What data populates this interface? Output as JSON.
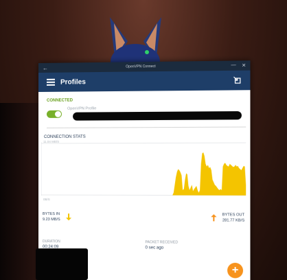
{
  "window": {
    "title": "OpenVPN Connect",
    "back_glyph": "←",
    "minimize_glyph": "—",
    "close_glyph": "✕"
  },
  "appbar": {
    "title": "Profiles",
    "menu_icon": "hamburger-icon",
    "import_icon": "import-profile-icon"
  },
  "status": {
    "label": "CONNECTED",
    "toggle_on": true,
    "profile_name": "OpenVPN Profile"
  },
  "stats": {
    "label": "CONNECTION STATS",
    "y_max_label": "11.04 MB/S",
    "y_min_label": "0B/S"
  },
  "chart_data": {
    "type": "area",
    "ylim": [
      0,
      100
    ],
    "values": [
      0,
      0,
      0,
      0,
      0,
      0,
      0,
      0,
      0,
      0,
      0,
      0,
      0,
      0,
      0,
      0,
      0,
      0,
      0,
      0,
      0,
      0,
      0,
      0,
      0,
      0,
      0,
      0,
      0,
      0,
      0,
      0,
      0,
      0,
      0,
      0,
      0,
      0,
      0,
      0,
      0,
      0,
      0,
      0,
      0,
      0,
      0,
      0,
      0,
      0,
      0,
      0,
      0,
      0,
      0,
      0,
      0,
      0,
      0,
      0,
      0,
      0,
      0,
      0,
      0,
      0,
      0,
      0,
      0,
      0,
      0,
      0,
      0,
      0,
      0,
      0,
      0,
      0,
      0,
      0,
      0,
      0,
      0,
      0,
      0,
      0,
      0,
      0,
      0,
      0,
      0,
      0,
      0,
      0,
      0,
      0,
      0,
      0,
      0,
      0,
      0,
      0,
      0,
      0,
      0,
      0,
      0,
      0,
      0,
      0,
      0,
      0,
      0,
      0,
      0,
      0,
      0,
      0,
      5,
      20,
      35,
      45,
      50,
      48,
      44,
      38,
      10,
      12,
      30,
      42,
      40,
      18,
      10,
      15,
      20,
      8,
      12,
      15,
      18,
      10,
      5,
      10,
      60,
      80,
      82,
      75,
      60,
      55,
      58,
      52,
      54,
      48,
      30,
      25,
      20,
      18,
      15,
      12,
      10,
      12,
      10,
      55,
      60,
      62,
      58,
      56,
      55,
      60,
      58,
      56,
      54,
      55,
      58,
      55,
      56,
      52,
      50,
      48,
      52,
      56,
      55,
      20
    ]
  },
  "bytes_in": {
    "label": "BYTES IN",
    "value": "9.23 MB/S",
    "arrow_color": "#f4c400"
  },
  "bytes_out": {
    "label": "BYTES OUT",
    "value": "281.77 KB/S",
    "arrow_color": "#f7931e"
  },
  "duration": {
    "label": "DURATION",
    "value": "00:24:09"
  },
  "packet": {
    "label": "PACKET RECEIVED",
    "value": "0 sec ago"
  },
  "fab": {
    "glyph": "+",
    "color": "#f7931e"
  },
  "colors": {
    "appbar": "#1e3e68",
    "connected": "#6aa11f",
    "chart_fill": "#f4c400"
  }
}
